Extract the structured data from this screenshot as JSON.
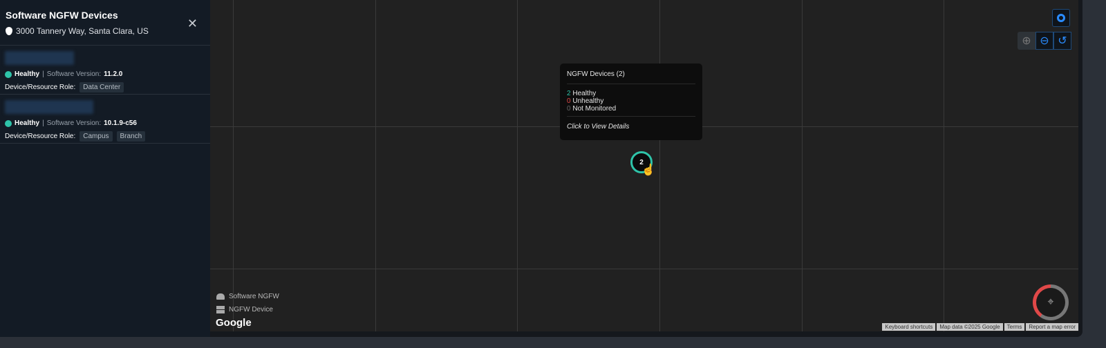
{
  "panel": {
    "title": "Software NGFW Devices",
    "address": "3000 Tannery Way, Santa Clara, US",
    "devices": [
      {
        "status": "Healthy",
        "version_label": "Software Version:",
        "version": "11.2.0",
        "role_label": "Device/Resource Role:",
        "roles": [
          "Data Center"
        ]
      },
      {
        "status": "Healthy",
        "version_label": "Software Version:",
        "version": "10.1.9-c56",
        "role_label": "Device/Resource Role:",
        "roles": [
          "Campus",
          "Branch"
        ]
      }
    ]
  },
  "tooltip": {
    "title": "NGFW Devices (2)",
    "healthy_count": "2",
    "healthy": "Healthy",
    "unhealthy_count": "0",
    "unhealthy": "Unhealthy",
    "nm_count": "0",
    "nm": "Not Monitored",
    "link": "Click to View Details"
  },
  "cluster": {
    "count": "2"
  },
  "legend": {
    "software": "Software NGFW",
    "device": "NGFW Device"
  },
  "map": {
    "brand": "Google",
    "attribution": [
      "Keyboard shortcuts",
      "Map data ©2025 Google",
      "Terms",
      "Report a map error"
    ]
  },
  "colors": {
    "healthy": "#2ec4a9",
    "unhealthy": "#e04848",
    "accent": "#2a8cff"
  }
}
